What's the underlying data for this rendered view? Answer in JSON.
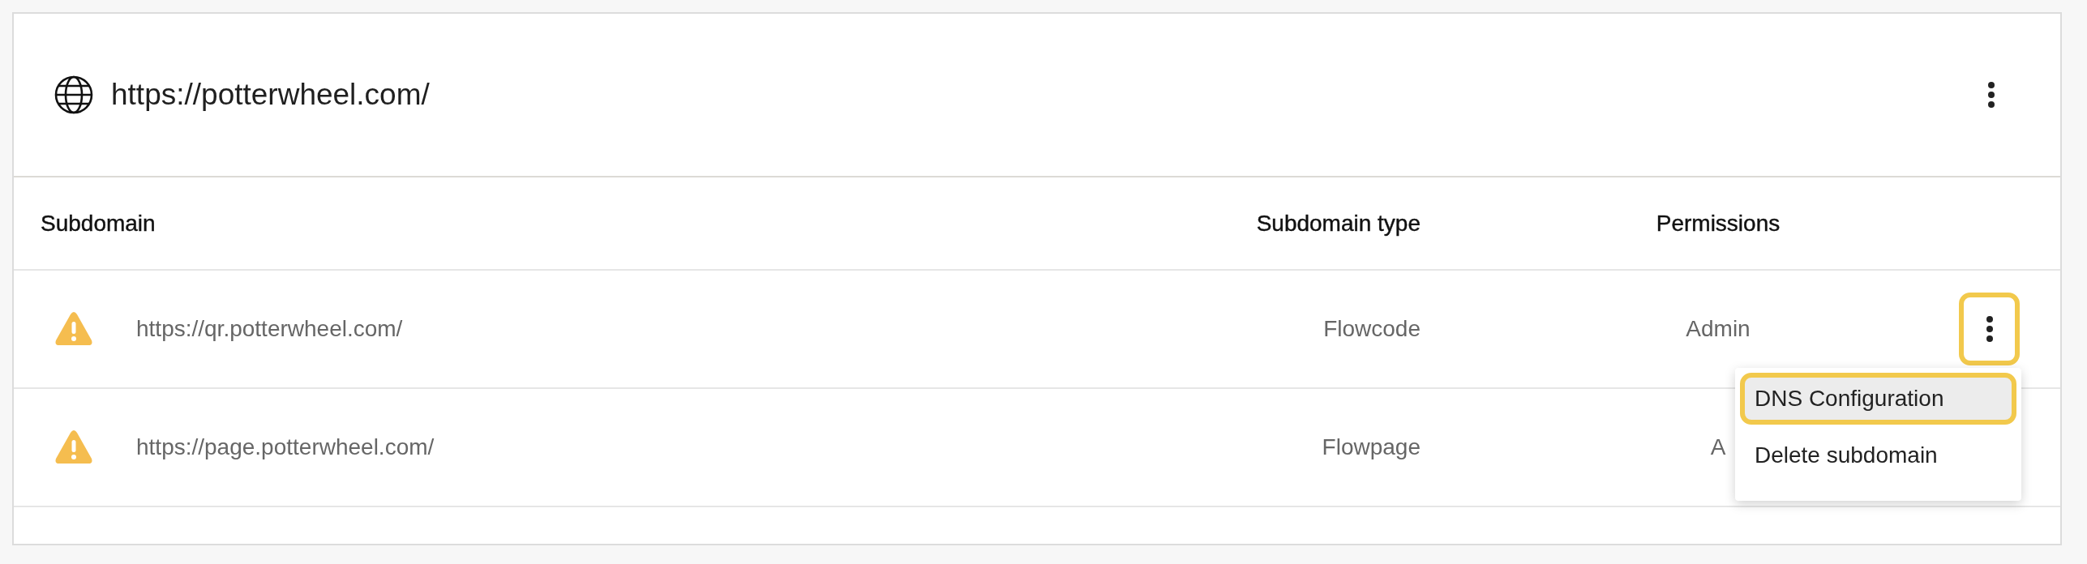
{
  "domain": {
    "title": "https://potterwheel.com/"
  },
  "table": {
    "columns": [
      "Subdomain",
      "Subdomain type",
      "Permissions"
    ],
    "rows": [
      {
        "kind": "warning",
        "subdomain": "https://qr.potterwheel.com/",
        "type": "Flowcode",
        "permissions": "Admin",
        "menu_button": {
          "highlighted": true
        }
      },
      {
        "kind": "warning",
        "subdomain": "https://page.potterwheel.com/",
        "type": "Flowpage",
        "permissions": "A"
      }
    ]
  },
  "menu": {
    "items": [
      {
        "label": "DNS Configuration",
        "selected": true,
        "highlighted": true
      },
      {
        "label": "Delete subdomain",
        "selected": false,
        "highlighted": false
      }
    ]
  }
}
